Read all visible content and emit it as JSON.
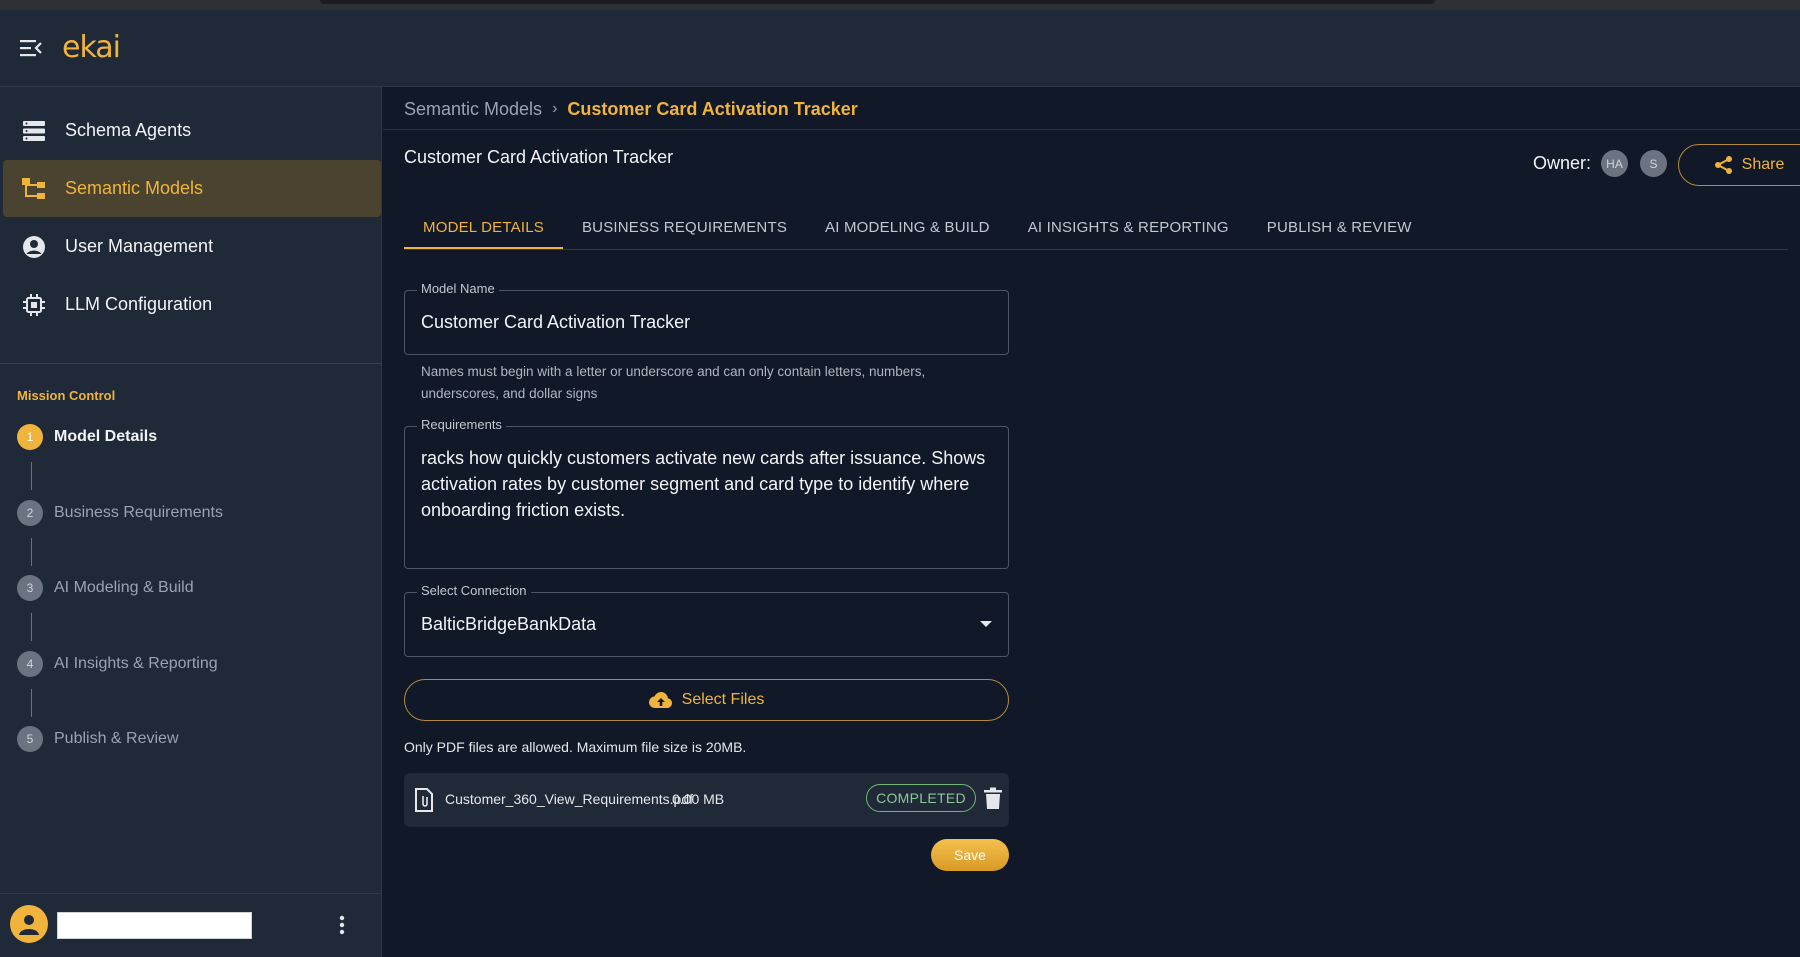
{
  "app": {
    "logo": "ekai"
  },
  "sidebar": {
    "nav": [
      {
        "label": "Schema Agents",
        "icon": "schema-list-icon"
      },
      {
        "label": "Semantic Models",
        "icon": "model-tree-icon",
        "active": true
      },
      {
        "label": "User Management",
        "icon": "user-circle-icon"
      },
      {
        "label": "LLM Configuration",
        "icon": "cpu-chip-icon"
      }
    ],
    "mission_control": {
      "title": "Mission Control",
      "steps": [
        {
          "num": "1",
          "label": "Model Details",
          "active": true
        },
        {
          "num": "2",
          "label": "Business Requirements"
        },
        {
          "num": "3",
          "label": "AI Modeling & Build"
        },
        {
          "num": "4",
          "label": "AI Insights & Reporting"
        },
        {
          "num": "5",
          "label": "Publish & Review"
        }
      ]
    }
  },
  "breadcrumb": {
    "parent": "Semantic Models",
    "separator": "›",
    "current": "Customer Card Activation Tracker"
  },
  "header": {
    "title": "Customer Card Activation Tracker",
    "owner_label": "Owner:",
    "owners": [
      "HA",
      "S"
    ],
    "share_label": "Share"
  },
  "tabs": [
    "MODEL DETAILS",
    "BUSINESS REQUIREMENTS",
    "AI MODELING & BUILD",
    "AI INSIGHTS & REPORTING",
    "PUBLISH & REVIEW"
  ],
  "form": {
    "model_name": {
      "label": "Model Name",
      "value": "Customer Card Activation Tracker",
      "helper": "Names must begin with a letter or underscore and can only contain letters, numbers, underscores, and dollar signs"
    },
    "requirements": {
      "label": "Requirements",
      "value": "racks how quickly customers activate new cards after issuance. Shows activation rates by customer segment and card type to identify where onboarding friction exists."
    },
    "connection": {
      "label": "Select Connection",
      "value": "BalticBridgeBankData"
    },
    "select_files_label": "Select Files",
    "file_note": "Only PDF files are allowed. Maximum file size is 20MB.",
    "file": {
      "name": "Customer_360_View_Requirements.pdf",
      "size": "0.00 MB",
      "status": "COMPLETED"
    },
    "save_label": "Save"
  },
  "colors": {
    "accent": "#f0b43c",
    "bg": "#111827",
    "panel": "#1f2937",
    "status_green": "#8cc892"
  }
}
